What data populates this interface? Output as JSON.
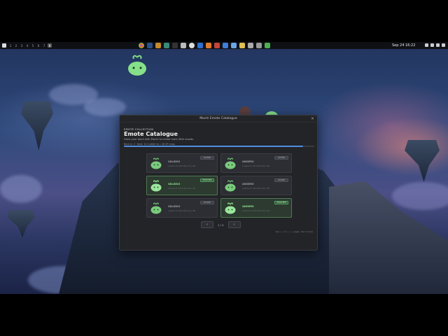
{
  "taskbar": {
    "workspaces": [
      "1",
      "2",
      "3",
      "4",
      "5",
      "6",
      "7",
      "8"
    ],
    "active_workspace": "8",
    "clock": "Sep 24  16:22"
  },
  "dialog": {
    "window_title": "Mochi Emote Catalogue",
    "close_label": "×",
    "kicker": "EMOTE COLLECTION",
    "heading": "Emote Catalogue",
    "subtitle": "Grow your bond with Mochi to reveal more little moods.",
    "stats": "Bond lv. 3 · Next: 10 Cuddle! to  ⟡ 48 XP mcgs",
    "progress_fraction": 0.94,
    "accent_color": "#4f8fe0",
    "unlocked_color": "#8fdf8f",
    "cards": [
      {
        "name": "VALIDSX",
        "desc": "a place to hold the ev'ry life",
        "badge": "LOCKED",
        "unlocked": false
      },
      {
        "name": "ANGERX",
        "desc": "a place to hold the ev'ry life",
        "badge": "LOCKED",
        "unlocked": false
      },
      {
        "name": "VALIDSX",
        "desc": "a place to hold the ev'ry life",
        "badge": "UNLOCKED",
        "unlocked": true
      },
      {
        "name": "ANGERX",
        "desc": "a place to hold the ev'ry life",
        "badge": "LOCKED",
        "unlocked": false
      },
      {
        "name": "VALIDSX",
        "desc": "a place to hold the ev'ry life",
        "badge": "LOCKED",
        "unlocked": false
      },
      {
        "name": "ANGERX",
        "desc": "a place to hold the ev'ry life",
        "badge": "UNLOCKED",
        "unlocked": true
      }
    ],
    "pager": {
      "prev": "‹",
      "page": "1 / 2",
      "next": "›"
    },
    "footnote": "Use ‹ / › or ← / → ·  pages  · Esc to close"
  }
}
